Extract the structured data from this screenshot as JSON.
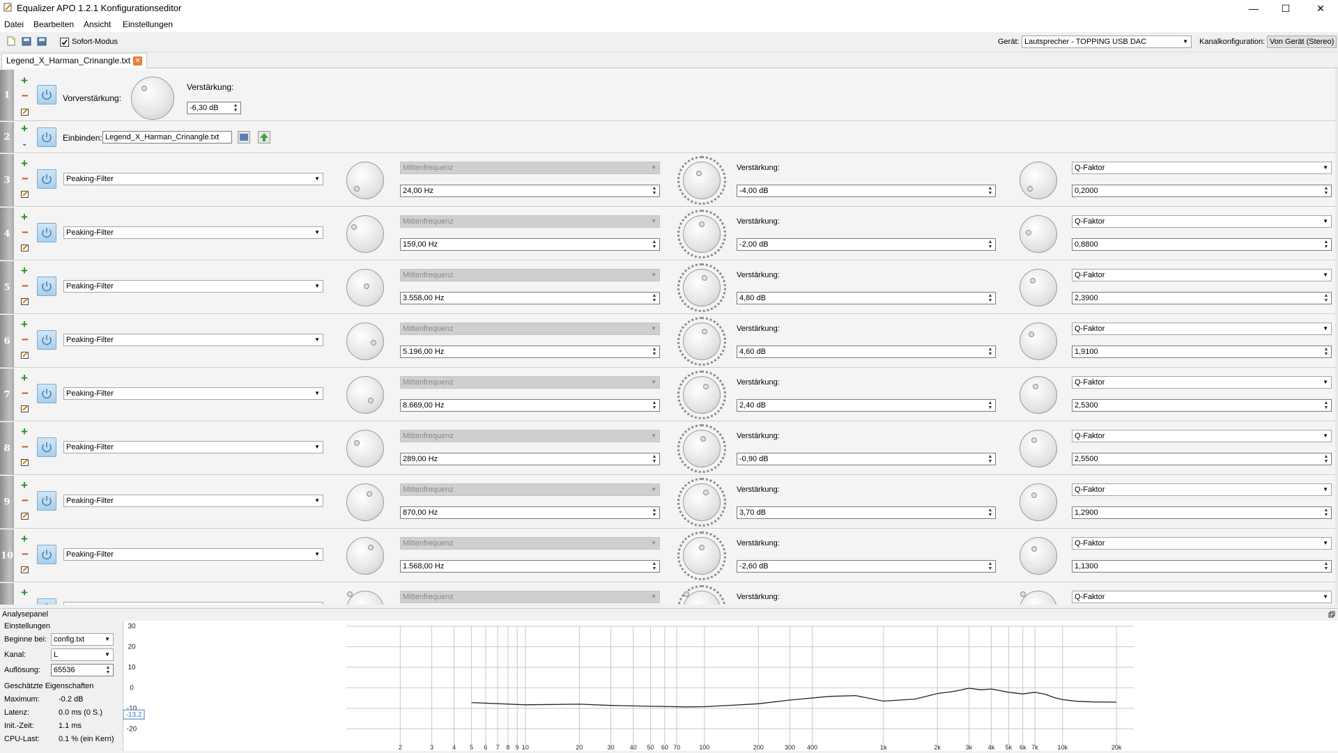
{
  "window": {
    "title": "Equalizer APO 1.2.1 Konfigurationseditor",
    "minimize": "—",
    "maximize": "☐",
    "close": "✕"
  },
  "menu": [
    "Datei",
    "Bearbeiten",
    "Ansicht",
    "Einstellungen"
  ],
  "toolbar": {
    "instant_mode_label": "Sofort-Modus",
    "instant_mode_checked": true,
    "device_label": "Gerät:",
    "device_value": "Lautsprecher - TOPPING USB DAC",
    "channel_config_label": "Kanalkonfiguration:",
    "channel_config_value": "Von Gerät (Stereo)"
  },
  "tab": {
    "name": "Legend_X_Harman_Crinangle.txt",
    "close": "✕"
  },
  "preamp": {
    "number": "1",
    "label": "Vorverstärkung:",
    "gain_label": "Verstärkung:",
    "gain_value": "-6,30 dB"
  },
  "include": {
    "number": "2",
    "label": "Einbinden:",
    "file": "Legend_X_Harman_Crinangle.txt"
  },
  "filter_type": "Peaking-Filter",
  "freq_label": "Mittenfrequenz",
  "gain_label": "Verstärkung:",
  "q_label": "Q-Faktor",
  "filters": [
    {
      "number": "3",
      "freq": "24,00 Hz",
      "gain": "-4,00 dB",
      "q": "0,2000"
    },
    {
      "number": "4",
      "freq": "159,00 Hz",
      "gain": "-2,00 dB",
      "q": "0,8800"
    },
    {
      "number": "5",
      "freq": "3.558,00 Hz",
      "gain": "4,80 dB",
      "q": "2,3900"
    },
    {
      "number": "6",
      "freq": "5.196,00 Hz",
      "gain": "4,60 dB",
      "q": "1,9100"
    },
    {
      "number": "7",
      "freq": "8.669,00 Hz",
      "gain": "2,40 dB",
      "q": "2,5300"
    },
    {
      "number": "8",
      "freq": "289,00 Hz",
      "gain": "-0,90 dB",
      "q": "2,5500"
    },
    {
      "number": "9",
      "freq": "870,00 Hz",
      "gain": "3,70 dB",
      "q": "1,2900"
    },
    {
      "number": "10",
      "freq": "1.568,00 Hz",
      "gain": "-2,60 dB",
      "q": "1,1300"
    },
    {
      "number": "",
      "freq": "",
      "gain": "",
      "q": ""
    }
  ],
  "analysis": {
    "panel_title": "Analysepanel",
    "settings_title": "Einstellungen",
    "start_label": "Beginne bei:",
    "start_value": "config.txt",
    "channel_label": "Kanal:",
    "channel_value": "L",
    "resolution_label": "Auflösung:",
    "resolution_value": "65536",
    "props_title": "Geschätzte Eigenschaften",
    "max_label": "Maximum:",
    "max_value": "-0.2 dB",
    "latency_label": "Latenz:",
    "latency_value": "0.0 ms (0 S.)",
    "init_label": "Init.-Zeit:",
    "init_value": "1.1 ms",
    "cpu_label": "CPU-Last:",
    "cpu_value": "0.1 % (ein Kern)",
    "cursor_value": "-13.2",
    "y_ticks": [
      "30",
      "20",
      "10",
      "0",
      "-10",
      "-20"
    ],
    "x_ticks": [
      "2",
      "3",
      "4",
      "5",
      "6",
      "7",
      "8",
      "9",
      "10",
      "20",
      "30",
      "40",
      "50",
      "60",
      "70",
      "100",
      "200",
      "300",
      "400",
      "1k",
      "2k",
      "3k",
      "4k",
      "5k",
      "6k",
      "7k",
      "10k",
      "20k"
    ]
  },
  "chart_data": {
    "type": "line",
    "xlabel": "",
    "ylabel": "",
    "x_scale": "log",
    "ylim": [
      -25,
      30
    ],
    "x": [
      5,
      10,
      20,
      30,
      50,
      80,
      100,
      150,
      200,
      300,
      500,
      700,
      1000,
      1500,
      2000,
      2500,
      3000,
      3500,
      4000,
      4500,
      5000,
      6000,
      7000,
      8000,
      9000,
      10000,
      12000,
      15000,
      20000
    ],
    "series": [
      {
        "values": [
          -7.2,
          -8.3,
          -8.0,
          -8.6,
          -9.0,
          -9.3,
          -9.2,
          -8.4,
          -7.8,
          -6.0,
          -4.2,
          -3.8,
          -6.5,
          -5.5,
          -2.8,
          -1.7,
          -0.2,
          -1.0,
          -0.6,
          -1.4,
          -2.2,
          -3.0,
          -2.2,
          -3.2,
          -4.8,
          -5.8,
          -6.6,
          -6.9,
          -7.0
        ]
      }
    ],
    "grid": true
  }
}
